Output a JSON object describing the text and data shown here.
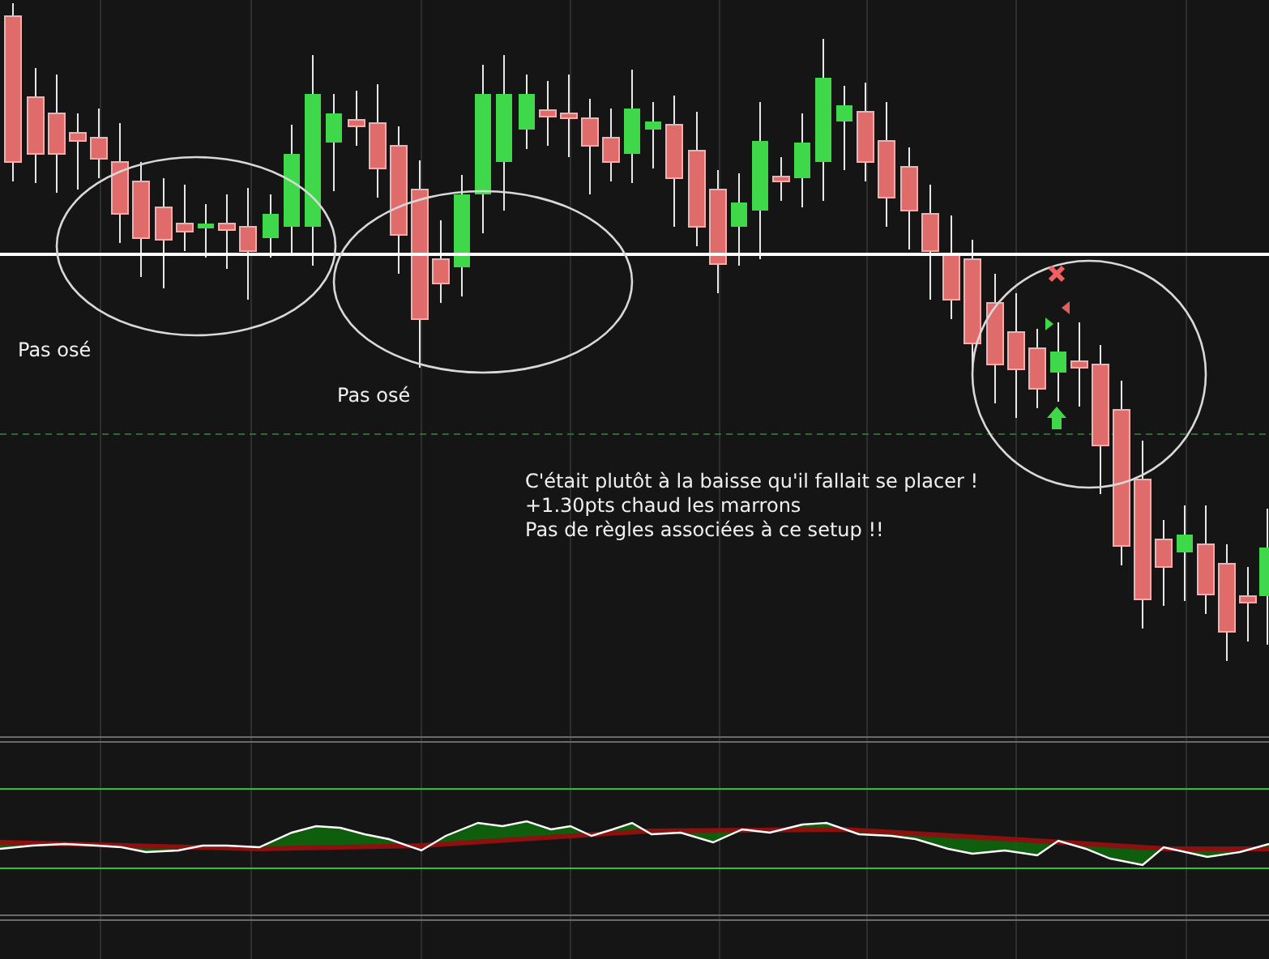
{
  "chart": {
    "labels": [
      {
        "text": "Pas osé"
      },
      {
        "text": "Pas osé"
      }
    ],
    "annotation": {
      "lines": [
        "C'était plutôt à la baisse qu'il fallait se placer !",
        "+1.30pts chaud les marrons",
        "Pas de règles associées à ce setup !!"
      ]
    }
  }
}
